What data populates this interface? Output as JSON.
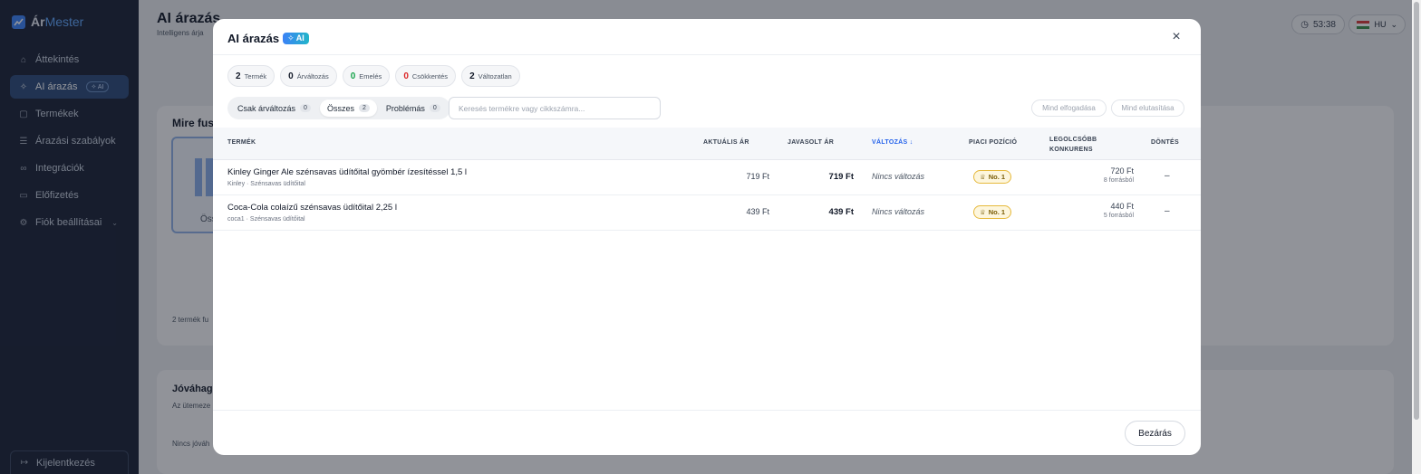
{
  "brand": {
    "part1": "Ár",
    "part2": "Mester"
  },
  "sidebar": {
    "items": [
      {
        "label": "Áttekintés",
        "icon": "home-icon"
      },
      {
        "label": "AI árazás",
        "icon": "sparkle-icon",
        "badge": "✧ AI"
      },
      {
        "label": "Termékek",
        "icon": "box-icon"
      },
      {
        "label": "Árazási szabályok",
        "icon": "sliders-icon"
      },
      {
        "label": "Integrációk",
        "icon": "link-icon"
      },
      {
        "label": "Előfizetés",
        "icon": "card-icon"
      },
      {
        "label": "Fiók beállításai",
        "icon": "gear-icon"
      }
    ],
    "logout": "Kijelentkezés"
  },
  "header": {
    "title": "AI árazás",
    "subtitle": "Intelligens árja",
    "timer": "53:38",
    "lang": "HU"
  },
  "background": {
    "card1_title": "Mire fus",
    "card1_inner_label": "Öss",
    "card1_footer": "2 termék fu",
    "card2_title": "Jóváhag",
    "card2_sub": "Az ütemeze",
    "card2_footer": "Nincs jóváh"
  },
  "modal": {
    "title": "AI árazás",
    "ai_badge": "✧ AI",
    "stats": [
      {
        "n": "2",
        "label": "Termék",
        "tone": "default"
      },
      {
        "n": "0",
        "label": "Árváltozás",
        "tone": "default"
      },
      {
        "n": "0",
        "label": "Emelés",
        "tone": "green"
      },
      {
        "n": "0",
        "label": "Csökkentés",
        "tone": "red"
      },
      {
        "n": "2",
        "label": "Változatlan",
        "tone": "default"
      }
    ],
    "filters": [
      {
        "label": "Csak árváltozás",
        "count": "0"
      },
      {
        "label": "Összes",
        "count": "2"
      },
      {
        "label": "Problémás",
        "count": "0"
      }
    ],
    "active_filter": "Összes",
    "search_placeholder": "Keresés termékre vagy cikkszámra...",
    "accept_all": "Mind elfogadása",
    "reject_all": "Mind elutasítása",
    "columns": {
      "product": "Termék",
      "current": "Aktuális ár",
      "suggested": "Javasolt ár",
      "change": "Változás ↓",
      "position": "Piaci pozíció",
      "competitor_l1": "Legolcsóbb",
      "competitor_l2": "konkurens",
      "decision": "Döntés"
    },
    "rows": [
      {
        "name": "Kinley Ginger Ale szénsavas üdítőital gyömbér ízesítéssel 1,5 l",
        "sub": "Kinley · Szénsavas üdítőital",
        "current": "719 Ft",
        "suggested": "719 Ft",
        "change": "Nincs változás",
        "position": "No. 1",
        "competitor_price": "720 Ft",
        "competitor_sources": "8 forrásból",
        "decision": "–"
      },
      {
        "name": "Coca-Cola colaízű szénsavas üdítőital 2,25 l",
        "sub": "coca1 · Szénsavas üdítőital",
        "current": "439 Ft",
        "suggested": "439 Ft",
        "change": "Nincs változás",
        "position": "No. 1",
        "competitor_price": "440 Ft",
        "competitor_sources": "5 forrásból",
        "decision": "–"
      }
    ],
    "close_label": "Bezárás"
  },
  "colors": {
    "accent": "#2563eb",
    "sidebar_bg": "#1a2236",
    "increase": "#16a34a",
    "decrease": "#dc2626"
  }
}
